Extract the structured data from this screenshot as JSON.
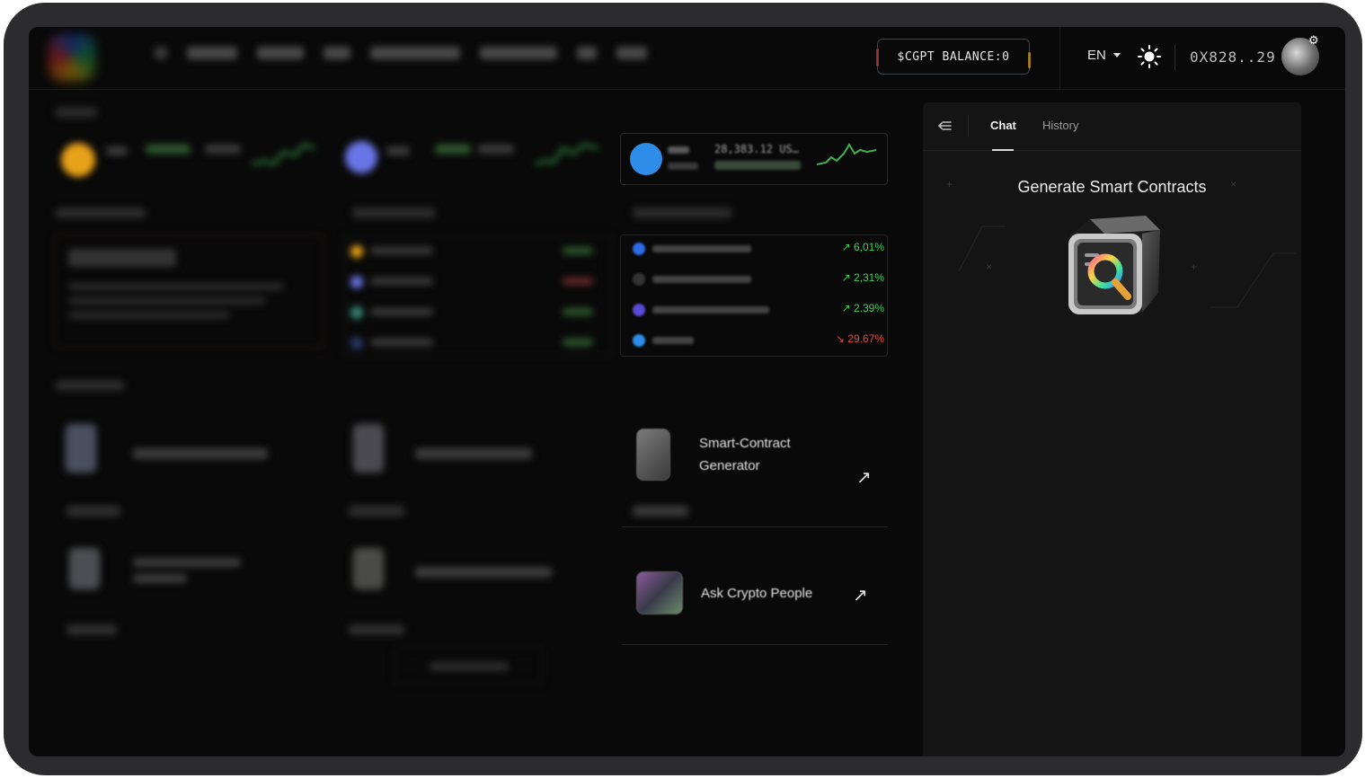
{
  "header": {
    "balance_label": "$CGPT BALANCE:0",
    "language": "EN",
    "wallet": "0X828..29",
    "theme_icon": "sun-icon",
    "settings_icon": "gear-icon"
  },
  "market": {
    "featured_price": "28,383.12 US…",
    "top_ai_tokens": [
      {
        "change": "6,01%",
        "direction": "up",
        "color": "#3ecf5a"
      },
      {
        "change": "2,31%",
        "direction": "up",
        "color": "#3ecf5a"
      },
      {
        "change": "2.39%",
        "direction": "up",
        "color": "#3ecf5a"
      },
      {
        "change": "29.67%",
        "direction": "down",
        "color": "#e5483b"
      }
    ]
  },
  "tools": [
    {
      "name": "Smart-Contract Generator"
    },
    {
      "name": "Ask Crypto People"
    }
  ],
  "panel": {
    "tabs": [
      "Chat",
      "History"
    ],
    "active_tab": "Chat",
    "title": "Generate Smart Contracts"
  }
}
